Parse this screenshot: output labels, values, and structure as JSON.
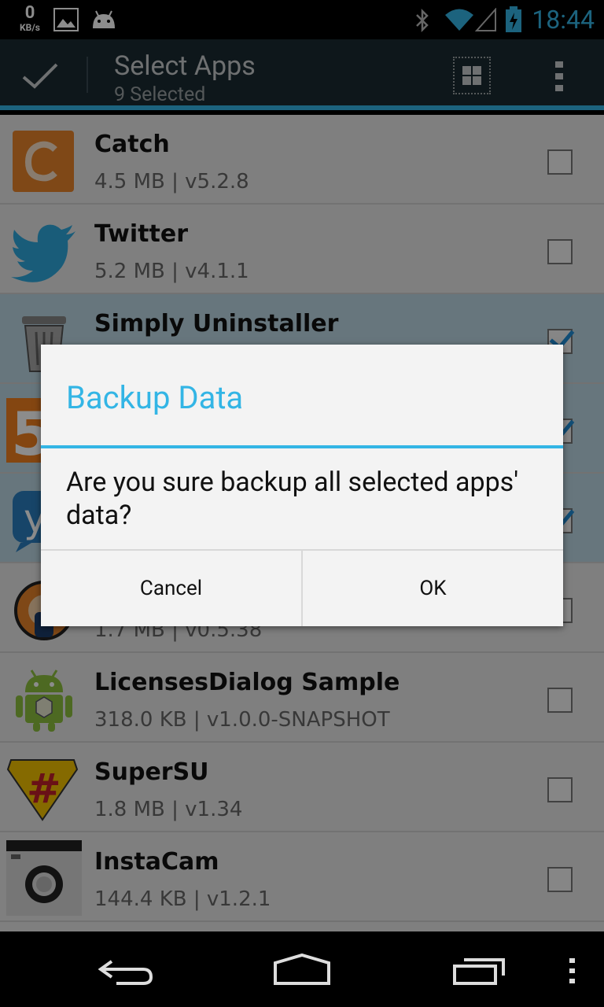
{
  "statusbar": {
    "speed_value": "0",
    "speed_unit": "KB/s",
    "time": "18:44",
    "icons": [
      "image-icon",
      "android-icon",
      "bluetooth-icon",
      "wifi-icon",
      "signal-icon",
      "battery-icon"
    ]
  },
  "actionbar": {
    "title": "Select Apps",
    "subtitle": "9 Selected",
    "icons": [
      "check-icon",
      "grid-icon",
      "overflow-menu-icon"
    ]
  },
  "apps": [
    {
      "name": "Catch",
      "meta": "4.5 MB | v5.2.8",
      "checked": false,
      "icon": "catch-icon"
    },
    {
      "name": "Twitter",
      "meta": "5.2 MB | v4.1.1",
      "checked": false,
      "icon": "twitter-icon"
    },
    {
      "name": "Simply Uninstaller",
      "meta": "",
      "checked": true,
      "icon": "trash-icon"
    },
    {
      "name": "",
      "meta": "",
      "checked": true,
      "icon": "five-icon"
    },
    {
      "name": "",
      "meta": "",
      "checked": true,
      "icon": "y-icon"
    },
    {
      "name": "",
      "meta": "1.7 MB | v0.5.38",
      "checked": false,
      "icon": "orange-app-icon"
    },
    {
      "name": "LicensesDialog Sample",
      "meta": "318.0 KB | v1.0.0-SNAPSHOT",
      "checked": false,
      "icon": "android-app-icon"
    },
    {
      "name": "SuperSU",
      "meta": "1.8 MB | v1.34",
      "checked": false,
      "icon": "supersu-icon"
    },
    {
      "name": "InstaCam",
      "meta": "144.4 KB | v1.2.1",
      "checked": false,
      "icon": "camera-icon"
    }
  ],
  "dialog": {
    "title": "Backup Data",
    "message": "Are you sure backup all selected apps' data?",
    "cancel_label": "Cancel",
    "ok_label": "OK"
  },
  "navbar": {
    "icons": [
      "back-icon",
      "home-icon",
      "recents-icon",
      "menu-icon"
    ]
  }
}
